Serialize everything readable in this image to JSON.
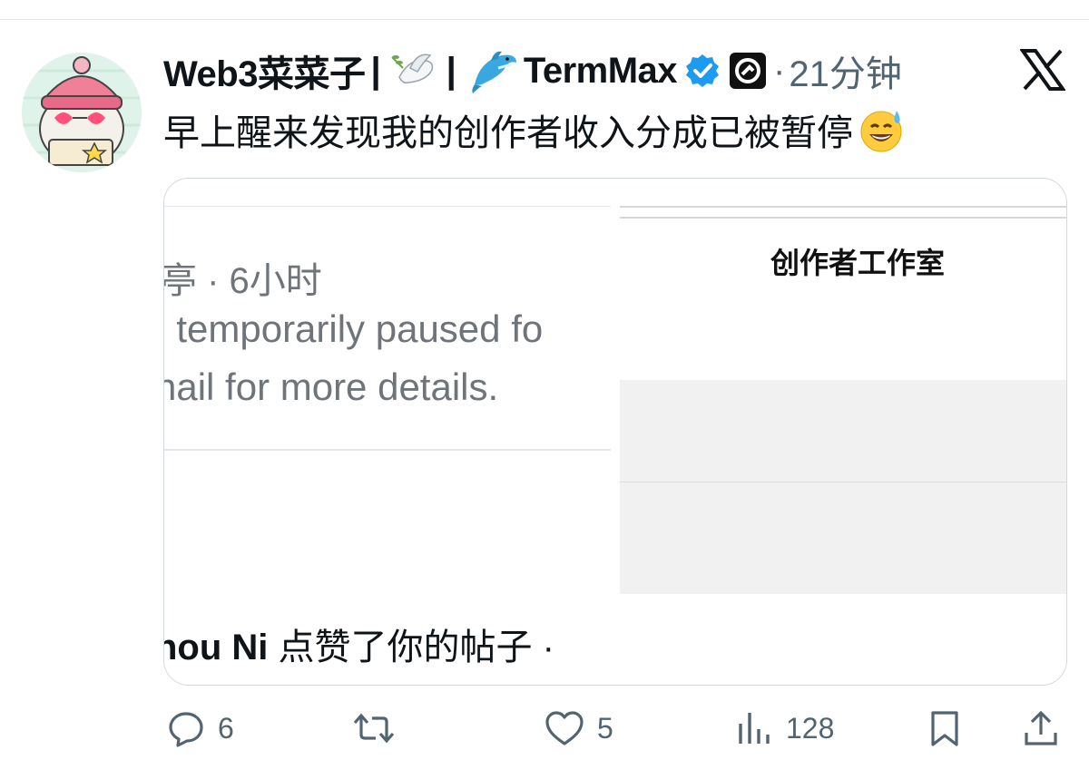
{
  "tweet": {
    "display_name": "Web3菜菜子",
    "name_separator": "|",
    "name_suffix": "TermMax",
    "dot": "·",
    "time": "21分钟",
    "text": "早上醒来发现我的创作者收入分成已被暂停"
  },
  "media": {
    "left_pane": {
      "meta": "亭 · 6小时",
      "line1": "ı temporarily paused fo",
      "line2": "nail for more details.",
      "notif_name": "nou Ni",
      "notif_text": " 点赞了你的帖子 ·"
    },
    "right_pane": {
      "title": "创作者工作室"
    }
  },
  "actions": {
    "replies": "6",
    "likes": "5",
    "views": "128"
  },
  "colors": {
    "verified": "#1d9bf0",
    "muted": "#536471",
    "text": "#0f1419"
  },
  "icons": [
    "avatar",
    "dove-emoji",
    "dolphin-emoji",
    "verified-badge-icon",
    "affiliate-badge-icon",
    "x-logo-icon",
    "sweat-smile-emoji",
    "reply-icon",
    "retweet-icon",
    "like-icon",
    "views-icon",
    "bookmark-icon",
    "share-icon"
  ]
}
